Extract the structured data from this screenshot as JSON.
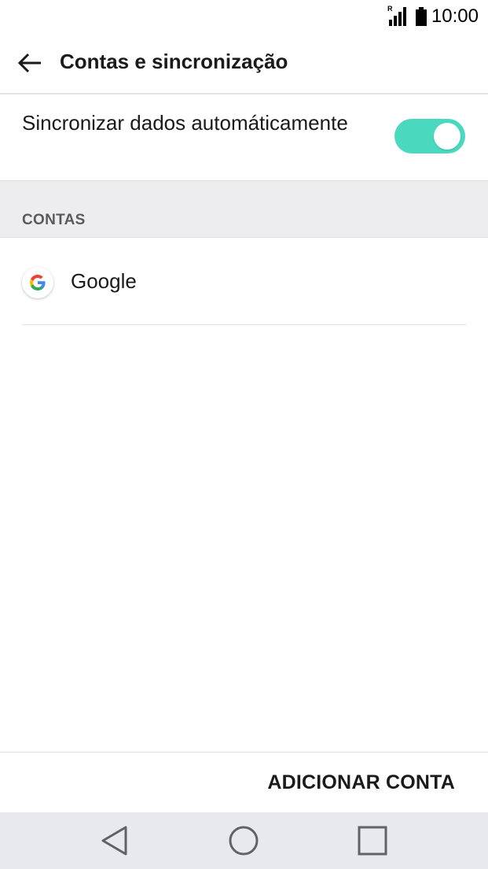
{
  "status_bar": {
    "time": "10:00",
    "roaming_indicator": "R",
    "icons": [
      "signal-icon",
      "battery-icon"
    ]
  },
  "toolbar": {
    "back_icon": "arrow-left-icon",
    "title": "Contas e sincronização"
  },
  "sync": {
    "label": "Sincronizar dados automáticamente",
    "enabled": true,
    "toggle_color": "#4ad9bf"
  },
  "accounts_section": {
    "header": "CONTAS",
    "items": [
      {
        "name": "Google",
        "icon": "google-icon"
      }
    ]
  },
  "actions": {
    "add_account": "ADICIONAR CONTA"
  },
  "nav_bar": {
    "icons": [
      "back-triangle-icon",
      "home-circle-icon",
      "recents-square-icon"
    ]
  }
}
